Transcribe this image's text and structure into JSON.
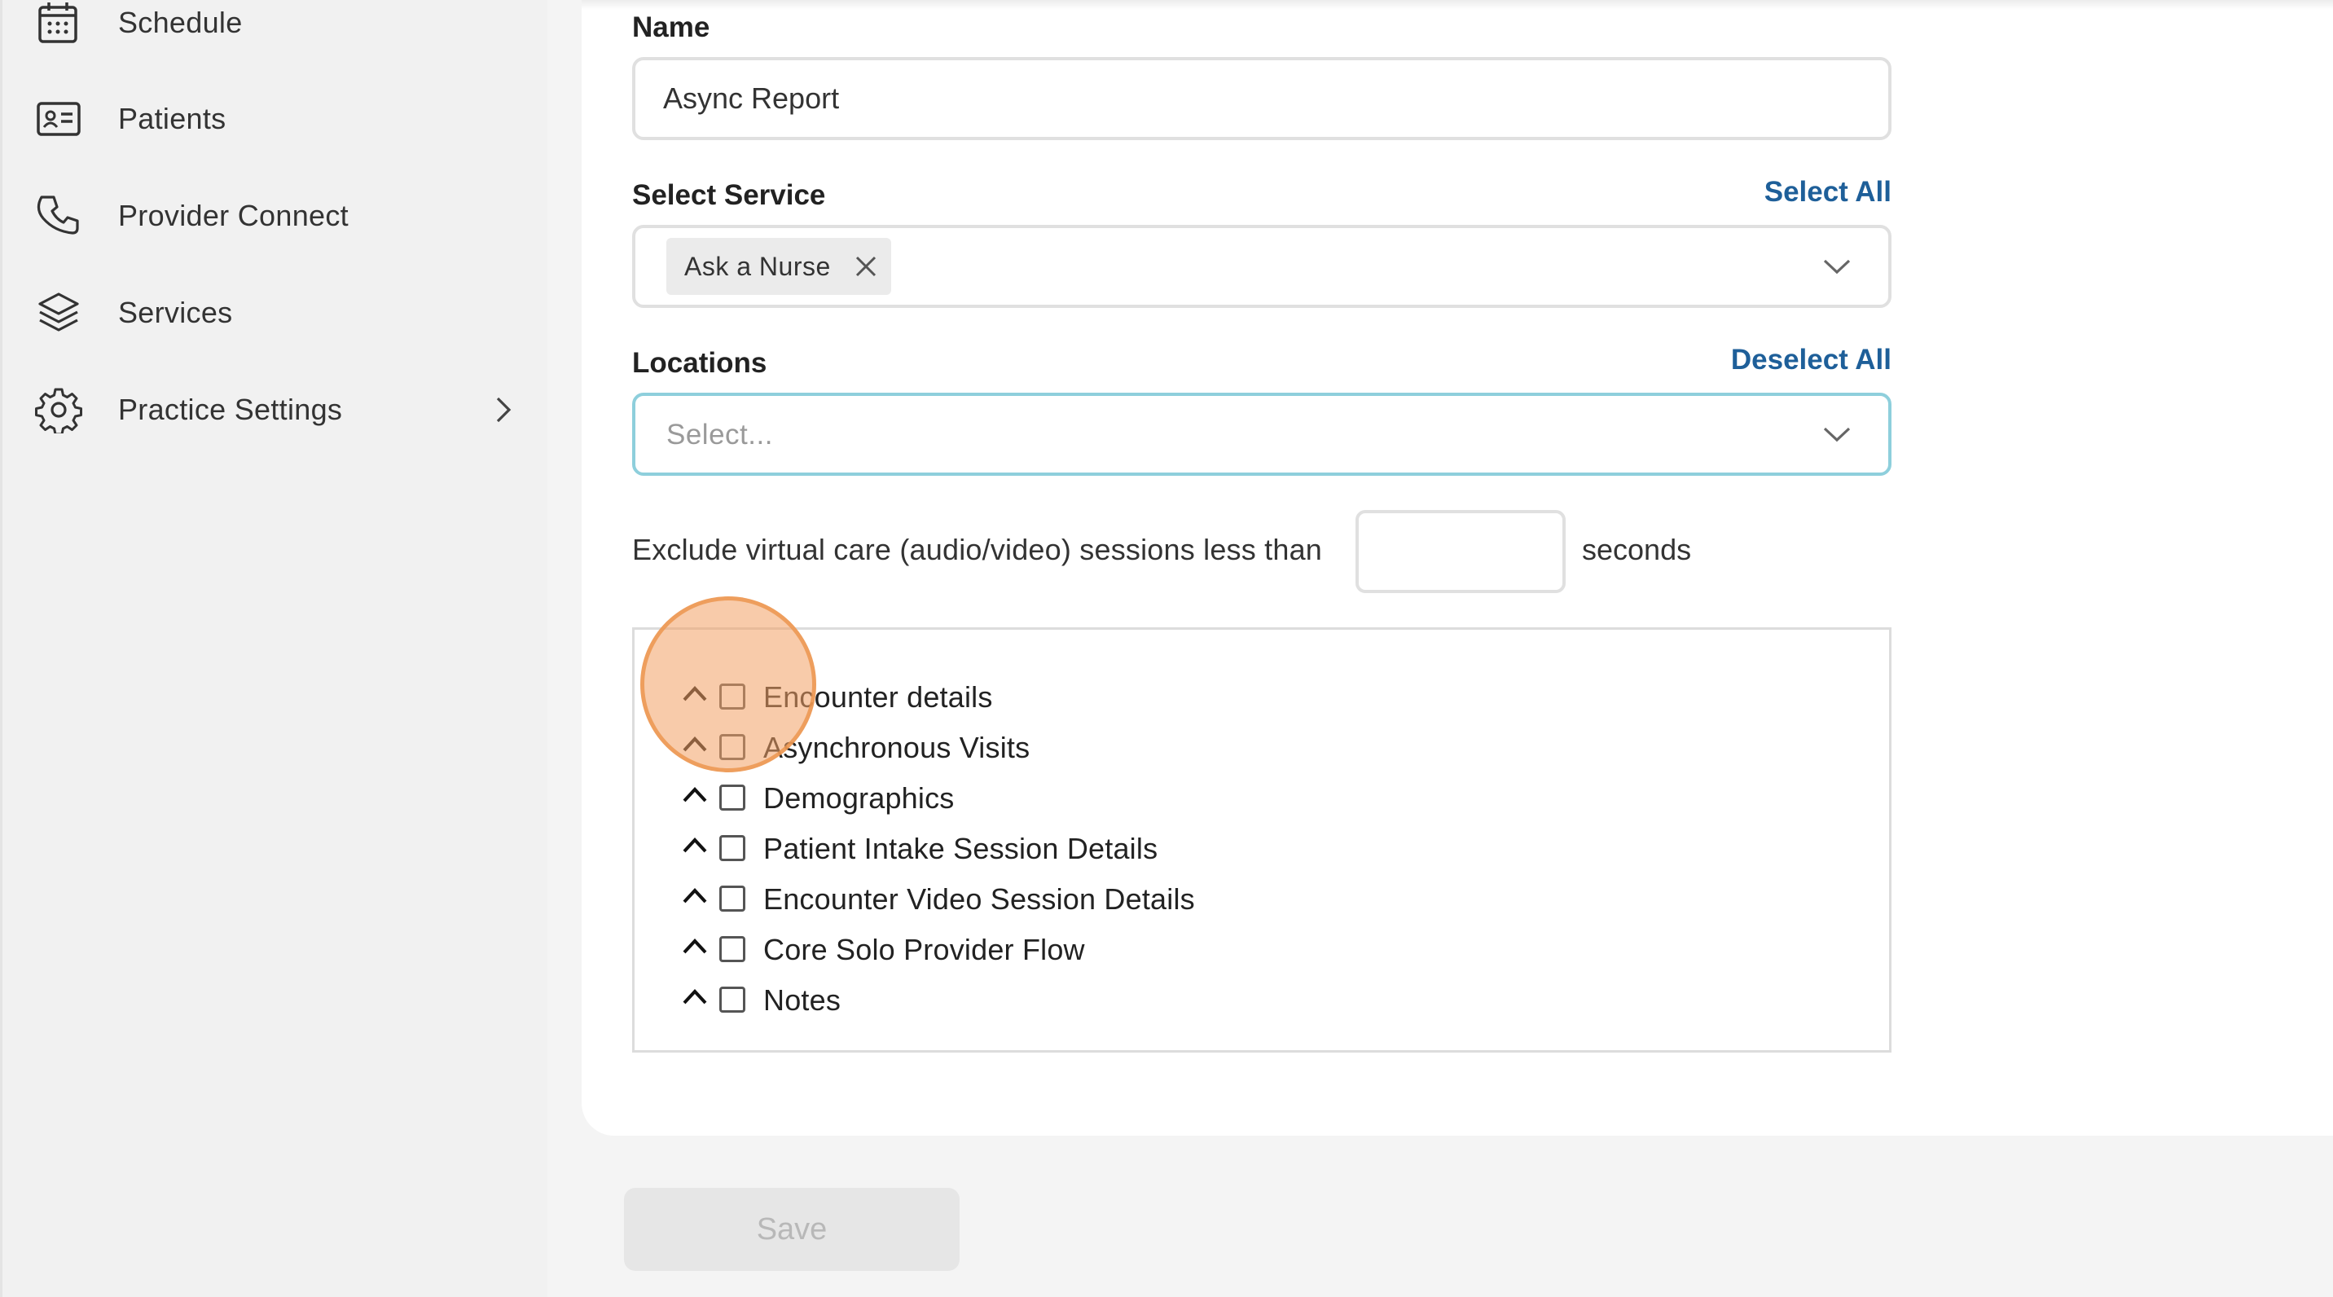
{
  "sidebar": {
    "items": [
      {
        "label": "Schedule",
        "icon": "calendar-icon"
      },
      {
        "label": "Patients",
        "icon": "id-card-icon"
      },
      {
        "label": "Provider Connect",
        "icon": "phone-icon"
      },
      {
        "label": "Services",
        "icon": "layers-icon"
      },
      {
        "label": "Practice Settings",
        "icon": "gear-icon",
        "has_submenu": true
      }
    ]
  },
  "form": {
    "name_label": "Name",
    "name_value": "Async Report",
    "service_label": "Select Service",
    "service_select_all": "Select All",
    "service_tags": [
      "Ask a Nurse"
    ],
    "locations_label": "Locations",
    "locations_deselect_all": "Deselect All",
    "locations_placeholder": "Select...",
    "exclude_text": "Exclude virtual care (audio/video) sessions less than",
    "seconds_value": "",
    "seconds_unit": "seconds",
    "tree": [
      {
        "label": "Encounter details",
        "checked": false
      },
      {
        "label": "Asynchronous Visits",
        "checked": false
      },
      {
        "label": "Demographics",
        "checked": false
      },
      {
        "label": "Patient Intake Session Details",
        "checked": false
      },
      {
        "label": "Encounter Video Session Details",
        "checked": false
      },
      {
        "label": "Core Solo Provider Flow",
        "checked": false
      },
      {
        "label": "Notes",
        "checked": false
      }
    ],
    "save_label": "Save"
  },
  "colors": {
    "link": "#1e5f99",
    "focus_border": "#8ecfdc",
    "highlight": "#f2a064"
  }
}
